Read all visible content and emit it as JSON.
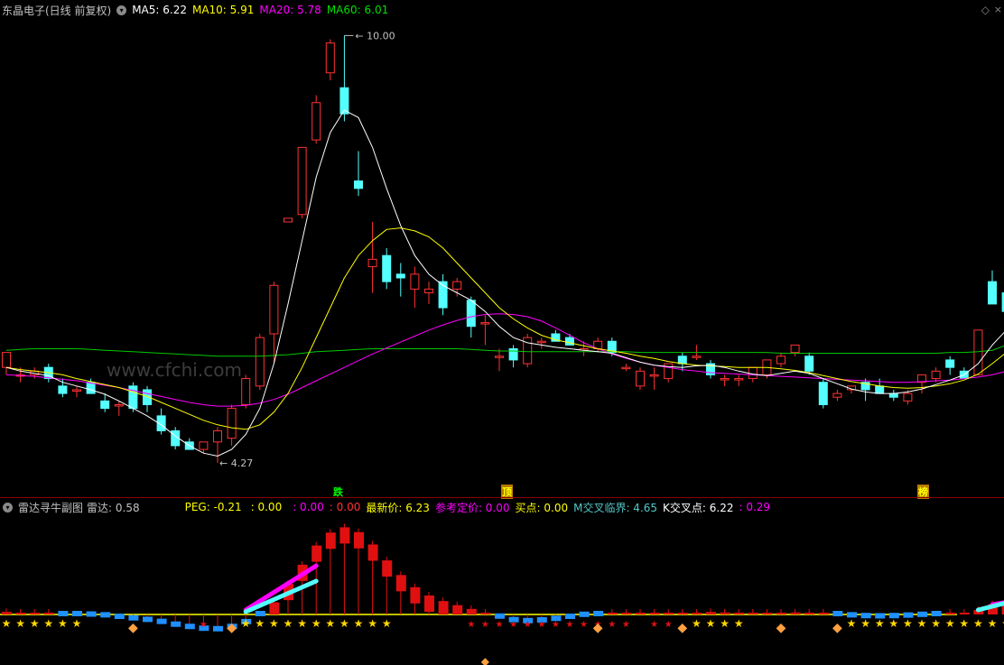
{
  "main_header": {
    "title": "东晶电子(日线 前复权)",
    "ma5": "MA5: 6.22",
    "ma10": "MA10: 5.91",
    "ma20": "MA20: 5.78",
    "ma60": "MA60: 6.01"
  },
  "sub_header": {
    "title": "雷达寻牛副图",
    "radar": "雷达: 0.58",
    "peg": "PEG: -0.21",
    "v1": ": 0.00",
    "v2": ": 0.00",
    "v3": ": 0.00",
    "latest": "最新价: 6.23",
    "ref_price": "参考定价: 0.00",
    "buy_point": "买点: 0.00",
    "m_cross": "M交叉临界: 4.65",
    "k_cross": "K交叉点: 6.22",
    "v4": ": 0.29"
  },
  "signals": {
    "s1": "跌",
    "s2": "顶",
    "s3": "榜"
  },
  "watermark": "www.cfchi.com",
  "chart_data": {
    "type": "candlestick",
    "high_label": "10.00",
    "low_label": "4.27",
    "candles": [
      [
        5.55,
        5.75,
        5.45,
        5.75
      ],
      [
        5.45,
        5.55,
        5.35,
        5.45
      ],
      [
        5.45,
        5.55,
        5.4,
        5.5
      ],
      [
        5.55,
        5.6,
        5.35,
        5.4
      ],
      [
        5.3,
        5.4,
        5.15,
        5.2
      ],
      [
        5.25,
        5.3,
        5.15,
        5.25
      ],
      [
        5.35,
        5.4,
        5.2,
        5.2
      ],
      [
        5.1,
        5.2,
        4.95,
        5.0
      ],
      [
        5.05,
        5.1,
        4.9,
        5.05
      ],
      [
        5.3,
        5.35,
        4.95,
        5.0
      ],
      [
        5.25,
        5.3,
        4.95,
        5.05
      ],
      [
        4.9,
        5.0,
        4.65,
        4.7
      ],
      [
        4.7,
        4.75,
        4.45,
        4.5
      ],
      [
        4.55,
        4.6,
        4.45,
        4.45
      ],
      [
        4.45,
        4.55,
        4.4,
        4.55
      ],
      [
        4.55,
        4.75,
        4.27,
        4.7
      ],
      [
        4.6,
        5.05,
        4.5,
        5.0
      ],
      [
        5.05,
        5.45,
        5.0,
        5.4
      ],
      [
        5.3,
        6.0,
        5.25,
        5.95
      ],
      [
        6.0,
        6.7,
        5.6,
        6.65
      ],
      [
        7.5,
        7.55,
        7.5,
        7.55
      ],
      [
        7.6,
        8.5,
        7.55,
        8.5
      ],
      [
        8.6,
        9.2,
        8.55,
        9.1
      ],
      [
        9.5,
        9.95,
        9.4,
        9.9
      ],
      [
        9.3,
        10.0,
        8.85,
        8.95
      ],
      [
        8.05,
        8.45,
        7.85,
        7.95
      ],
      [
        6.9,
        7.5,
        6.55,
        7.0
      ],
      [
        7.05,
        7.15,
        6.6,
        6.7
      ],
      [
        6.8,
        6.95,
        6.5,
        6.75
      ],
      [
        6.6,
        6.9,
        6.35,
        6.8
      ],
      [
        6.55,
        6.7,
        6.4,
        6.6
      ],
      [
        6.7,
        6.8,
        6.25,
        6.35
      ],
      [
        6.6,
        6.75,
        6.5,
        6.7
      ],
      [
        6.45,
        6.5,
        5.95,
        6.1
      ],
      [
        6.15,
        6.25,
        5.85,
        6.15
      ],
      [
        5.7,
        5.8,
        5.5,
        5.7
      ],
      [
        5.8,
        5.85,
        5.55,
        5.65
      ],
      [
        5.6,
        6.0,
        5.55,
        5.95
      ],
      [
        5.9,
        5.95,
        5.8,
        5.9
      ],
      [
        6.0,
        6.05,
        5.9,
        5.9
      ],
      [
        5.95,
        6.0,
        5.85,
        5.85
      ],
      [
        5.8,
        5.9,
        5.7,
        5.8
      ],
      [
        5.8,
        5.95,
        5.75,
        5.9
      ],
      [
        5.9,
        5.95,
        5.7,
        5.75
      ],
      [
        5.55,
        5.6,
        5.5,
        5.55
      ],
      [
        5.3,
        5.55,
        5.25,
        5.5
      ],
      [
        5.45,
        5.55,
        5.25,
        5.45
      ],
      [
        5.4,
        5.6,
        5.35,
        5.6
      ],
      [
        5.7,
        5.75,
        5.5,
        5.6
      ],
      [
        5.7,
        5.85,
        5.65,
        5.7
      ],
      [
        5.6,
        5.65,
        5.4,
        5.45
      ],
      [
        5.4,
        5.45,
        5.3,
        5.4
      ],
      [
        5.4,
        5.45,
        5.3,
        5.4
      ],
      [
        5.4,
        5.5,
        5.35,
        5.55
      ],
      [
        5.45,
        5.65,
        5.4,
        5.65
      ],
      [
        5.6,
        5.75,
        5.55,
        5.7
      ],
      [
        5.75,
        5.85,
        5.7,
        5.85
      ],
      [
        5.7,
        5.75,
        5.45,
        5.5
      ],
      [
        5.35,
        5.4,
        5.0,
        5.05
      ],
      [
        5.15,
        5.25,
        5.1,
        5.2
      ],
      [
        5.25,
        5.3,
        5.2,
        5.3
      ],
      [
        5.35,
        5.4,
        5.1,
        5.25
      ],
      [
        5.3,
        5.4,
        5.2,
        5.2
      ],
      [
        5.2,
        5.25,
        5.1,
        5.15
      ],
      [
        5.1,
        5.25,
        5.05,
        5.2
      ],
      [
        5.35,
        5.4,
        5.2,
        5.45
      ],
      [
        5.4,
        5.55,
        5.35,
        5.5
      ],
      [
        5.65,
        5.7,
        5.45,
        5.55
      ],
      [
        5.5,
        5.55,
        5.4,
        5.4
      ],
      [
        5.45,
        6.05,
        5.45,
        6.05
      ],
      [
        6.7,
        6.85,
        6.4,
        6.4
      ],
      [
        6.55,
        6.85,
        6.3,
        6.3
      ],
      [
        6.2,
        6.4,
        6.05,
        6.25
      ]
    ],
    "ma5": [
      5.55,
      5.5,
      5.47,
      5.44,
      5.35,
      5.3,
      5.25,
      5.19,
      5.1,
      5.0,
      4.9,
      4.78,
      4.63,
      4.5,
      4.4,
      4.36,
      4.45,
      4.65,
      5.0,
      5.6,
      6.4,
      7.25,
      8.1,
      8.7,
      9.0,
      8.9,
      8.5,
      7.95,
      7.45,
      7.05,
      6.8,
      6.65,
      6.55,
      6.45,
      6.3,
      6.1,
      5.95,
      5.88,
      5.85,
      5.82,
      5.8,
      5.78,
      5.76,
      5.74,
      5.68,
      5.62,
      5.58,
      5.56,
      5.55,
      5.57,
      5.58,
      5.55,
      5.5,
      5.46,
      5.44,
      5.47,
      5.5,
      5.47,
      5.4,
      5.33,
      5.26,
      5.22,
      5.2,
      5.2,
      5.22,
      5.26,
      5.32,
      5.38,
      5.45,
      5.6,
      5.85,
      6.05,
      6.22
    ],
    "ma10": [
      5.55,
      5.52,
      5.5,
      5.48,
      5.45,
      5.4,
      5.36,
      5.32,
      5.28,
      5.22,
      5.16,
      5.08,
      5.0,
      4.92,
      4.84,
      4.78,
      4.74,
      4.72,
      4.78,
      4.95,
      5.2,
      5.55,
      5.95,
      6.35,
      6.75,
      7.05,
      7.25,
      7.4,
      7.42,
      7.38,
      7.3,
      7.15,
      6.95,
      6.75,
      6.55,
      6.35,
      6.2,
      6.08,
      5.98,
      5.92,
      5.88,
      5.84,
      5.8,
      5.77,
      5.74,
      5.7,
      5.67,
      5.63,
      5.6,
      5.58,
      5.57,
      5.56,
      5.55,
      5.55,
      5.55,
      5.53,
      5.51,
      5.48,
      5.44,
      5.4,
      5.36,
      5.33,
      5.3,
      5.28,
      5.27,
      5.28,
      5.3,
      5.33,
      5.38,
      5.46,
      5.6,
      5.75,
      5.91
    ],
    "ma20": [
      5.45,
      5.44,
      5.43,
      5.41,
      5.39,
      5.37,
      5.34,
      5.31,
      5.28,
      5.24,
      5.2,
      5.16,
      5.12,
      5.08,
      5.05,
      5.03,
      5.03,
      5.04,
      5.07,
      5.12,
      5.19,
      5.28,
      5.37,
      5.46,
      5.55,
      5.64,
      5.73,
      5.81,
      5.89,
      5.97,
      6.05,
      6.12,
      6.18,
      6.23,
      6.26,
      6.27,
      6.26,
      6.23,
      6.17,
      6.08,
      5.98,
      5.88,
      5.8,
      5.73,
      5.67,
      5.62,
      5.58,
      5.55,
      5.52,
      5.5,
      5.48,
      5.47,
      5.46,
      5.45,
      5.44,
      5.43,
      5.42,
      5.41,
      5.4,
      5.39,
      5.38,
      5.37,
      5.36,
      5.35,
      5.35,
      5.36,
      5.37,
      5.38,
      5.4,
      5.42,
      5.45,
      5.5,
      5.78
    ],
    "ma60": [
      5.78,
      5.79,
      5.8,
      5.8,
      5.8,
      5.8,
      5.79,
      5.78,
      5.77,
      5.76,
      5.75,
      5.74,
      5.73,
      5.72,
      5.71,
      5.7,
      5.7,
      5.7,
      5.7,
      5.71,
      5.72,
      5.74,
      5.76,
      5.77,
      5.78,
      5.79,
      5.8,
      5.8,
      5.8,
      5.8,
      5.8,
      5.8,
      5.8,
      5.79,
      5.78,
      5.77,
      5.77,
      5.76,
      5.76,
      5.76,
      5.76,
      5.76,
      5.76,
      5.76,
      5.76,
      5.75,
      5.75,
      5.75,
      5.75,
      5.75,
      5.75,
      5.75,
      5.75,
      5.75,
      5.75,
      5.74,
      5.74,
      5.74,
      5.74,
      5.74,
      5.74,
      5.74,
      5.74,
      5.74,
      5.74,
      5.74,
      5.74,
      5.75,
      5.75,
      5.76,
      5.78,
      5.85,
      6.01
    ]
  },
  "colors": {
    "up": "#ff3232",
    "down": "#54ffff",
    "ma5": "#ffffff",
    "ma10": "#ffff00",
    "ma20": "#ff00ff",
    "ma60": "#00c800",
    "title": "#c0c0c0"
  }
}
